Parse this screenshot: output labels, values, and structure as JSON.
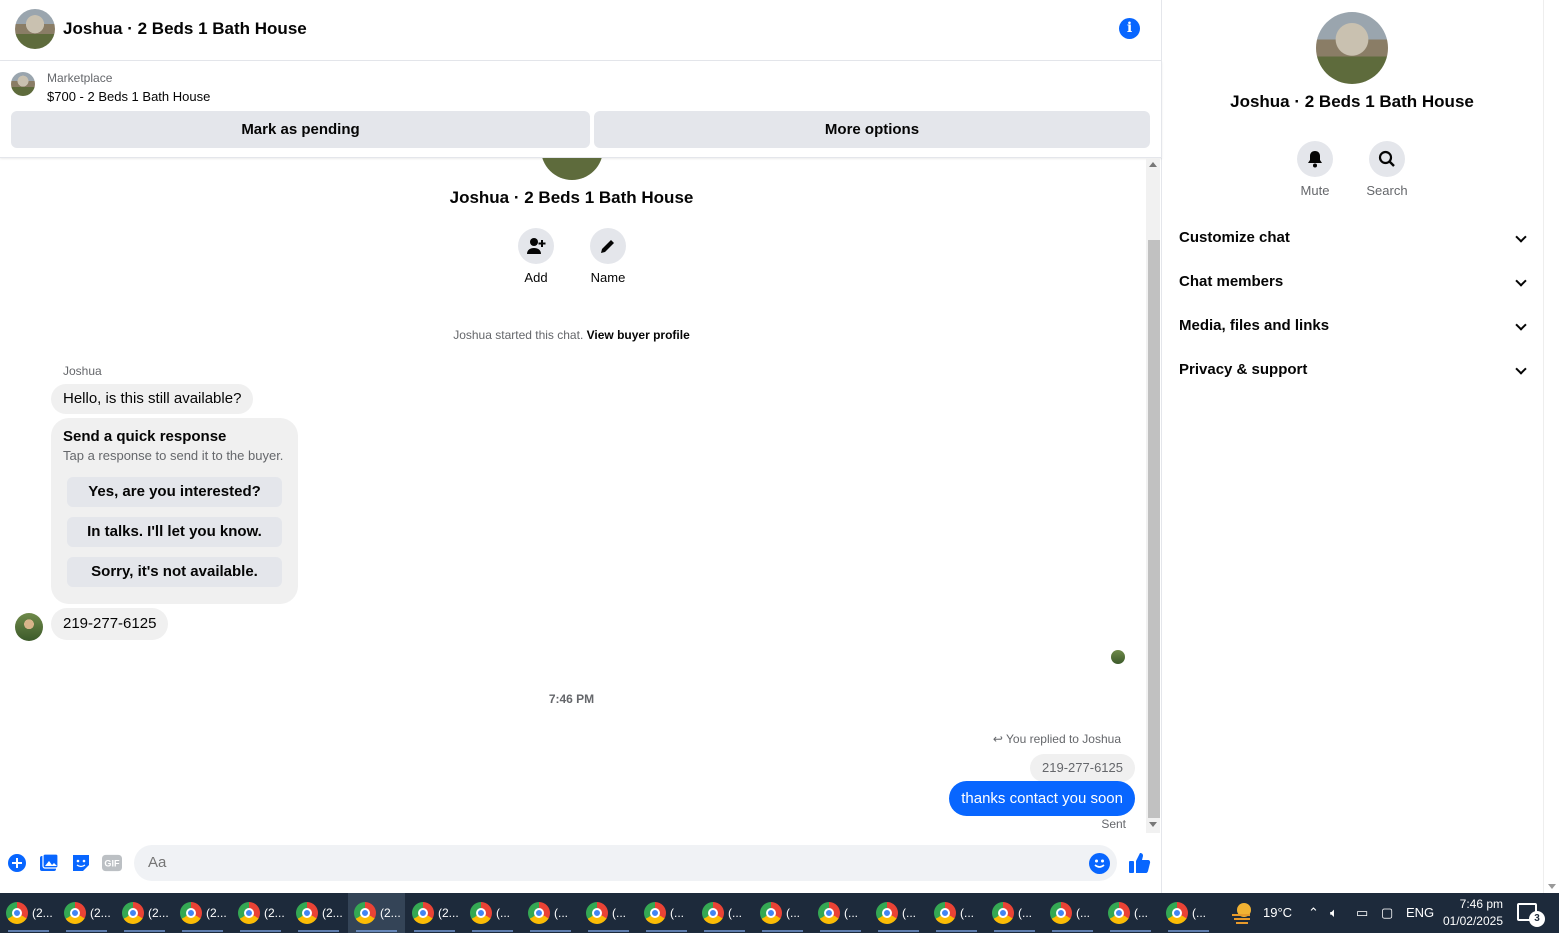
{
  "header": {
    "title": "Joshua · 2 Beds 1 Bath House",
    "info_icon": "info-icon"
  },
  "listing": {
    "source": "Marketplace",
    "item": "$700 - 2 Beds 1 Bath House",
    "mark_pending": "Mark as pending",
    "more_options": "More options"
  },
  "thread": {
    "name": "Joshua · 2 Beds 1 Bath House",
    "actions": {
      "add": "Add",
      "name": "Name"
    },
    "started": "Joshua started this chat.",
    "view_profile": "View buyer profile",
    "sender": "Joshua",
    "msg1": "Hello, is this still available?",
    "quick": {
      "title": "Send a quick response",
      "subtitle": "Tap a response to send it to the buyer.",
      "options": [
        "Yes, are you interested?",
        "In talks. I'll let you know.",
        "Sorry, it's not available."
      ]
    },
    "msg2": "219-277-6125",
    "time": "7:46 PM",
    "replied": "You replied to Joshua",
    "quoted": "219-277-6125",
    "reply": "thanks contact you soon",
    "status": "Sent"
  },
  "composer": {
    "placeholder": "Aa",
    "gif_label": "GIF"
  },
  "panel": {
    "title": "Joshua · 2 Beds 1 Bath House",
    "mute": "Mute",
    "search": "Search",
    "sections": [
      "Customize chat",
      "Chat members",
      "Media, files and links",
      "Privacy & support"
    ]
  },
  "taskbar": {
    "items": [
      "(2...",
      "(2...",
      "(2...",
      "(2...",
      "(2...",
      "(2...",
      "(2...",
      "(2...",
      "(...",
      "(...",
      "(...",
      "(...",
      "(...",
      "(...",
      "(...",
      "(...",
      "(...",
      "(...",
      "(...",
      "(...",
      "(..."
    ],
    "active_index": 6,
    "weather": "19°C",
    "language": "ENG",
    "time": "7:46 pm",
    "date": "01/02/2025",
    "notifications": "3"
  },
  "colors": {
    "accent": "#0866ff",
    "bubble_in": "#f0f0f0",
    "button_grey": "#e4e6eb",
    "taskbar": "#1d2a3b"
  }
}
